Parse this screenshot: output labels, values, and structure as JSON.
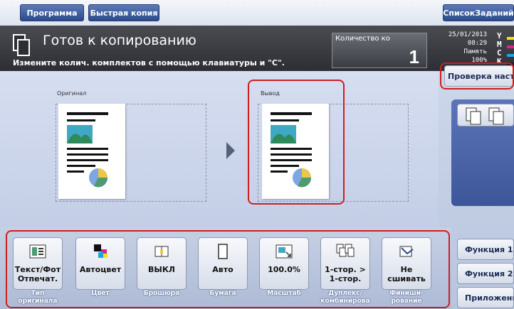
{
  "topbar": {
    "program_label": "Программа",
    "quick_copy_label": "Быстрая копия",
    "job_list_label": "СписокЗаданий"
  },
  "status": {
    "title": "Готов к копированию",
    "message": "Измените колич. комплектов с помощью клавиатуры и \"C\".",
    "qty_label": "Количество ко",
    "qty_value": "1",
    "date": "25/01/2013",
    "time": "08:29",
    "memory_label": "Память",
    "memory_value": "100%",
    "toner": [
      {
        "label": "Y",
        "color": "#f2e21a"
      },
      {
        "label": "M",
        "color": "#e0218a"
      },
      {
        "label": "C",
        "color": "#19a7e0"
      },
      {
        "label": "K",
        "color": "#222222"
      }
    ]
  },
  "preview": {
    "original_label": "Оригинал",
    "output_label": "Вывод"
  },
  "right": {
    "check_settings_label": "Проверка настро",
    "function1_label": "Функция 1",
    "function2_label": "Функция 2",
    "app_label": "Приложение"
  },
  "functions": [
    {
      "name": "original-type",
      "value": "Текст/Фот Отпечат.",
      "label": "Тип оригинала",
      "icon": "photo-text-icon"
    },
    {
      "name": "color",
      "value": "Автоцвет",
      "label": "Цвет",
      "icon": "color-icon"
    },
    {
      "name": "booklet",
      "value": "ВЫКЛ",
      "label": "Брошюра",
      "icon": "booklet-icon"
    },
    {
      "name": "paper",
      "value": "Авто",
      "label": "Бумага",
      "icon": "paper-icon"
    },
    {
      "name": "zoom",
      "value": "100.0%",
      "label": "Масштаб",
      "icon": "zoom-icon"
    },
    {
      "name": "duplex",
      "value": "1-стор. > 1-стор.",
      "label": "Дуплекс/ комбинирова",
      "icon": "duplex-icon"
    },
    {
      "name": "finishing",
      "value": "Не сшивать",
      "label": "Финиши- рование",
      "icon": "staple-icon"
    }
  ]
}
